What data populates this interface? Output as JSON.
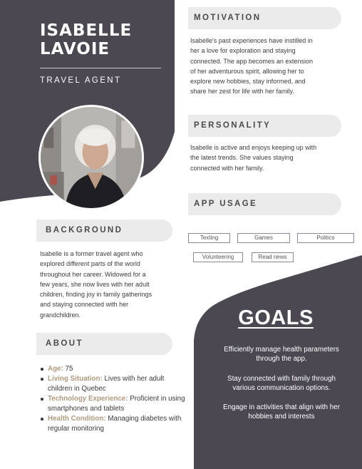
{
  "colors": {
    "dark": "#4b4852",
    "pill": "#ebebeb",
    "accent": "#b09a7e",
    "white": "#ffffff"
  },
  "profile": {
    "first_name": "ISABELLE",
    "last_name": "LAVOIE",
    "role": "TRAVEL AGENT",
    "photo": "portrait-photo"
  },
  "motivation": {
    "heading": "MOTIVATION",
    "lines": [
      "Isabelle's past experiences have instilled in",
      "her a love for exploration and staying",
      "connected. The app becomes an extension",
      "of her adventurous spirit, allowing her to",
      "explore new hobbies, stay informed, and",
      "share her zest for life with her family."
    ]
  },
  "personality": {
    "heading": "PERSONALITY",
    "lines": [
      "Isabelle is active and enjoys keeping up with",
      "the latest trends. She values staying",
      "connected with her family."
    ]
  },
  "app_usage": {
    "heading": "APP USAGE",
    "tags": [
      "Texting",
      "Games",
      "Politics",
      "Volunteering",
      "Read news"
    ]
  },
  "background": {
    "heading": "BACKGROUND",
    "lines": [
      "Isabelle is a former travel agent who",
      "explored different parts of the world",
      "throughout her career. Widowed for a",
      "few years, she now lives with her adult",
      "children, finding joy in family gatherings",
      "and staying connected with her",
      "grandchildren."
    ]
  },
  "about": {
    "heading": "ABOUT",
    "items": [
      {
        "key": "Age:",
        "value": " 75"
      },
      {
        "key": "Living Situation:",
        "value": " Lives with her adult children in Quebec"
      },
      {
        "key": "Technology Experience:",
        "value": " Proficient in using smartphones and tablets"
      },
      {
        "key": "Health Condition:",
        "value": " Managing diabetes with regular monitoring"
      }
    ]
  },
  "goals": {
    "heading": "GOALS",
    "items": [
      [
        "Efficiently manage health parameters",
        "through the app."
      ],
      [
        "Stay connected with family through",
        "various communication options."
      ],
      [
        "Engage in activities that align with her",
        "hobbies and interests"
      ]
    ]
  }
}
